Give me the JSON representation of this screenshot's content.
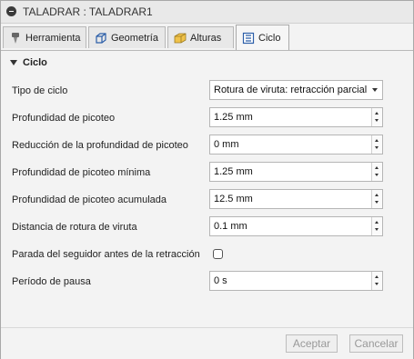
{
  "window": {
    "title": "TALADRAR : TALADRAR1"
  },
  "tabs": [
    {
      "label": "Herramienta",
      "icon": "drill-tool-icon"
    },
    {
      "label": "Geometría",
      "icon": "cube-icon"
    },
    {
      "label": "Alturas",
      "icon": "heights-icon"
    },
    {
      "label": "Ciclo",
      "icon": "cycle-icon",
      "active": true
    }
  ],
  "section": {
    "title": "Ciclo"
  },
  "fields": {
    "cycle_type": {
      "label": "Tipo de ciclo",
      "value": "Rotura de viruta: retracción parcial"
    },
    "peck_depth": {
      "label": "Profundidad de picoteo",
      "value": "1.25 mm"
    },
    "peck_reduction": {
      "label": "Reducción de la profundidad de picoteo",
      "value": "0 mm"
    },
    "min_peck_depth": {
      "label": "Profundidad de picoteo mínima",
      "value": "1.25 mm"
    },
    "accum_peck_depth": {
      "label": "Profundidad de picoteo acumulada",
      "value": "12.5 mm"
    },
    "chip_break_distance": {
      "label": "Distancia de rotura de viruta",
      "value": "0.1 mm"
    },
    "stop_follower": {
      "label": "Parada del seguidor antes de la retracción",
      "checked": false
    },
    "dwell_period": {
      "label": "Período de pausa",
      "value": "0 s"
    }
  },
  "buttons": {
    "accept": "Aceptar",
    "cancel": "Cancelar"
  }
}
